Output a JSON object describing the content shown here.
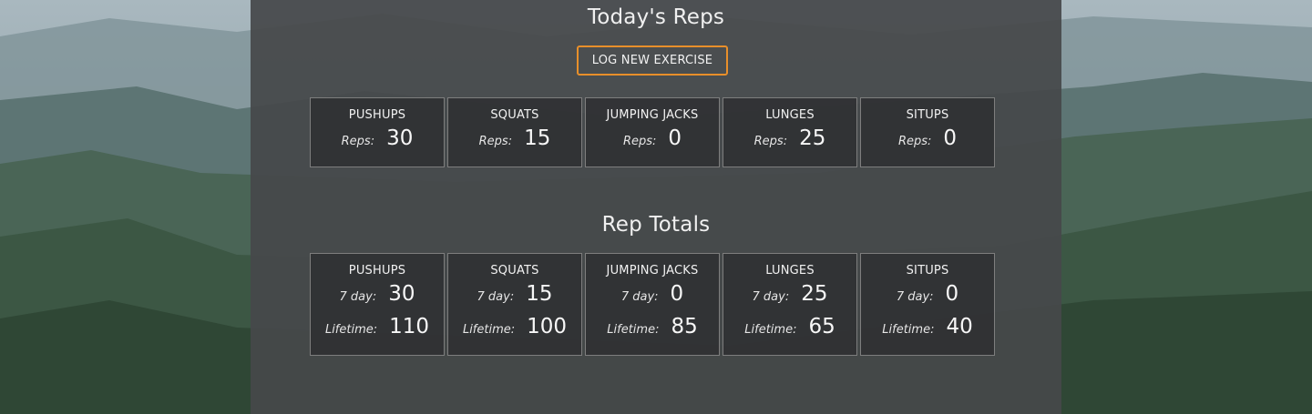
{
  "colors": {
    "panel_bg": "#46484a",
    "card_bg": "#2e2f31",
    "card_border": "#7e7e7e",
    "accent": "#e88f2a",
    "text": "#f0f0f0"
  },
  "background": {
    "description_icon": "mountain-landscape-image"
  },
  "today": {
    "title": "Today's Reps",
    "log_button": "LOG NEW EXERCISE",
    "reps_label": "Reps:",
    "exercises": [
      {
        "name": "PUSHUPS",
        "reps": "30"
      },
      {
        "name": "SQUATS",
        "reps": "15"
      },
      {
        "name": "JUMPING JACKS",
        "reps": "0"
      },
      {
        "name": "LUNGES",
        "reps": "25"
      },
      {
        "name": "SITUPS",
        "reps": "0"
      }
    ]
  },
  "totals": {
    "title": "Rep Totals",
    "seven_day_label": "7 day:",
    "lifetime_label": "Lifetime:",
    "exercises": [
      {
        "name": "PUSHUPS",
        "seven_day": "30",
        "lifetime": "110"
      },
      {
        "name": "SQUATS",
        "seven_day": "15",
        "lifetime": "100"
      },
      {
        "name": "JUMPING JACKS",
        "seven_day": "0",
        "lifetime": "85"
      },
      {
        "name": "LUNGES",
        "seven_day": "25",
        "lifetime": "65"
      },
      {
        "name": "SITUPS",
        "seven_day": "0",
        "lifetime": "40"
      }
    ]
  }
}
